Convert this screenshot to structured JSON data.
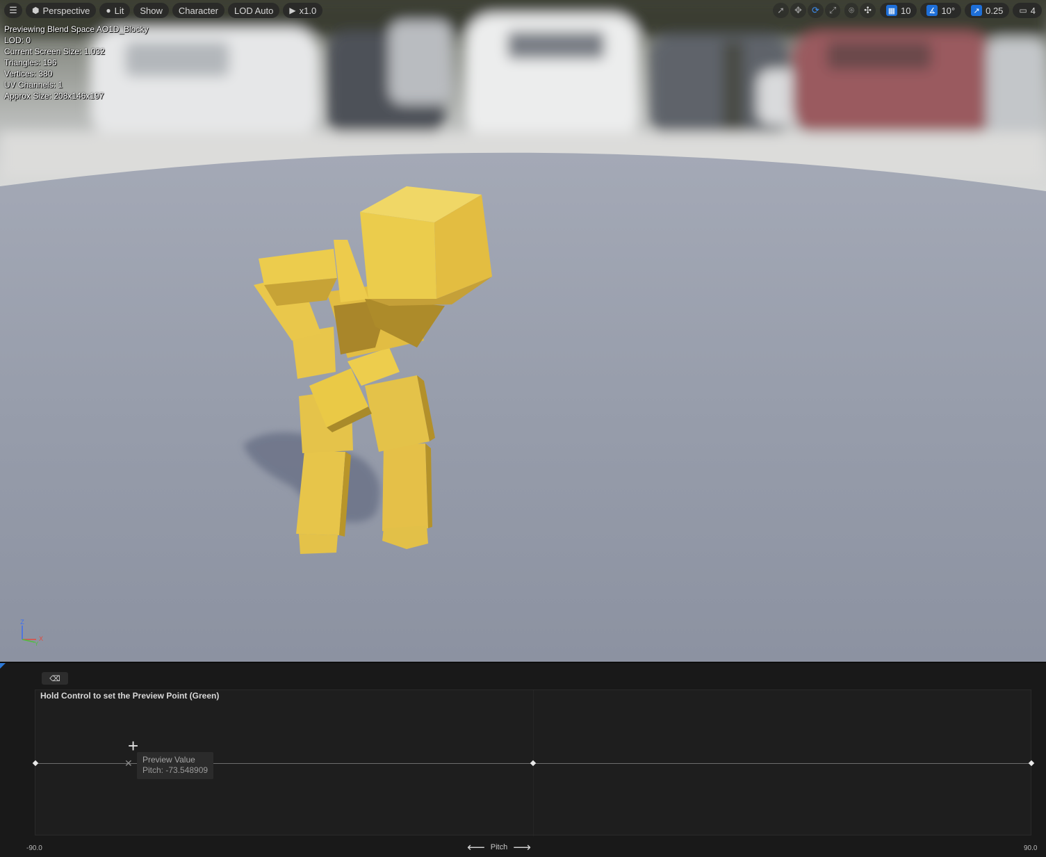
{
  "toolbar": {
    "menu_icon": "hamburger-icon",
    "perspective_label": "Perspective",
    "lit_label": "Lit",
    "show_label": "Show",
    "character_label": "Character",
    "lod_label": "LOD Auto",
    "play_speed_label": "x1.0",
    "grid_snap_value": "10",
    "rotation_snap_value": "10°",
    "scale_snap_value": "0.25",
    "camera_speed_value": "4",
    "right_icons": [
      "select-icon",
      "translate-icon",
      "rotate-icon",
      "scale-icon",
      "world-local-icon",
      "surface-snap-icon",
      "grid-snap-icon",
      "rotation-snap-icon",
      "scale-snap-icon",
      "camera-speed-icon"
    ],
    "accent_color": "#1e6fd8"
  },
  "stats": {
    "line1": "Previewing Blend Space AO1D_Blocky",
    "line2": "LOD: 0",
    "line3": "Current Screen Size: 1.032",
    "line4": "Triangles: 196",
    "line5": "Vertices: 380",
    "line6": "UV Channels: 1",
    "line7": "Approx Size: 208x146x197"
  },
  "gizmo": {
    "z": "Z",
    "x": "X",
    "y": "Y"
  },
  "panel": {
    "toggle_icon": "tag-icon",
    "hint": "Hold Control to set the Preview Point (Green)",
    "tooltip_title": "Preview Value",
    "tooltip_value": "Pitch: -73.548909",
    "preview_value": -73.548909,
    "axis_min": "-90.0",
    "axis_max": "90.0",
    "axis_name": "Pitch",
    "samples": [
      -90.0,
      0.0,
      90.0
    ]
  },
  "colors": {
    "character": "#e8c54a",
    "floor": "#9aa0ad",
    "panel_bg": "#191919"
  }
}
